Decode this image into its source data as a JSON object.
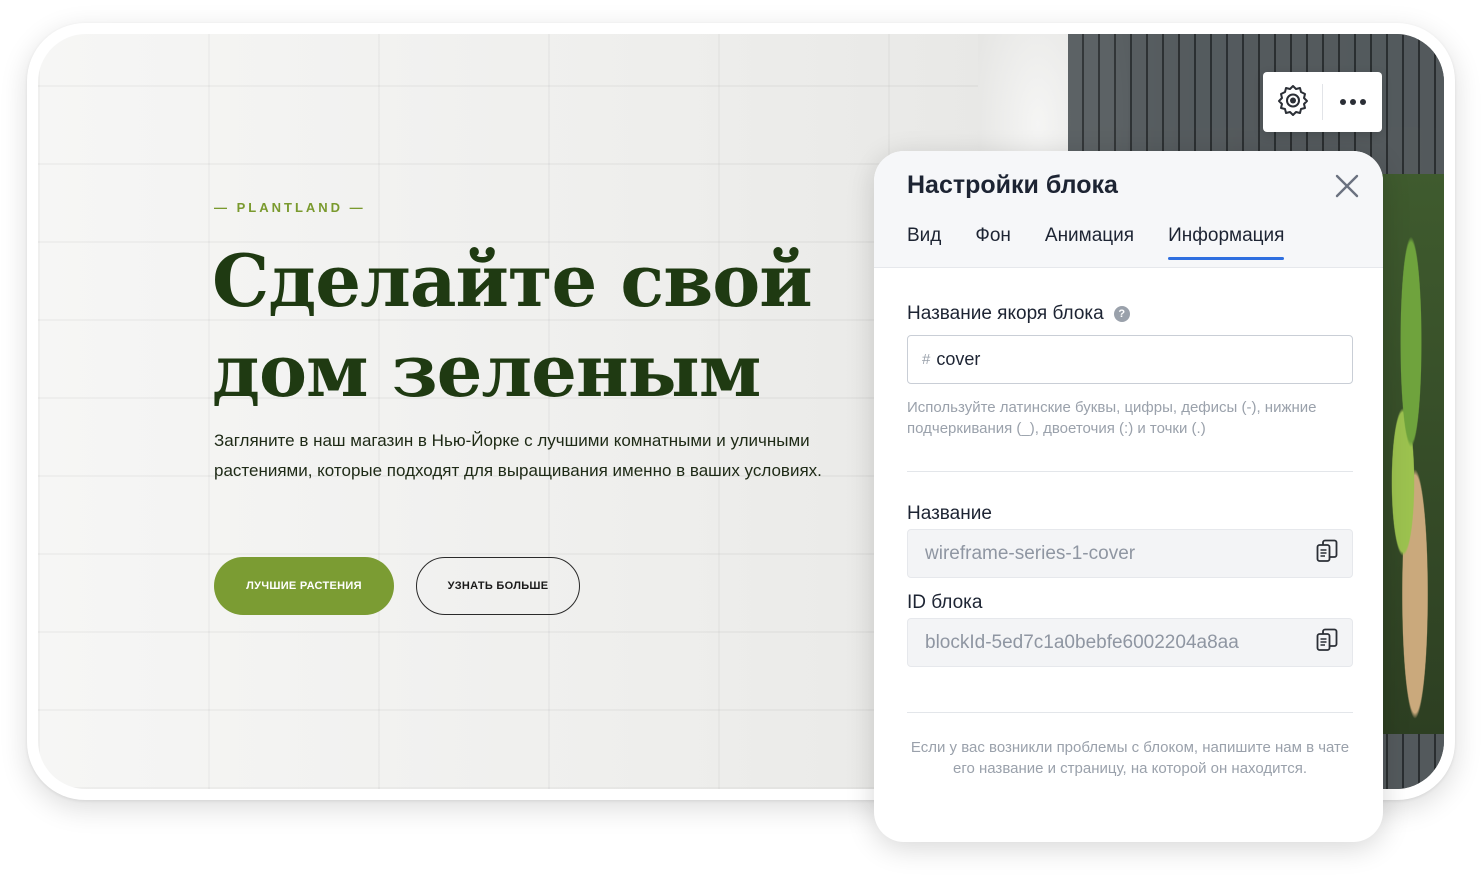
{
  "hero": {
    "eyebrow": "— PLANTLAND —",
    "headline": "Сделайте свой дом зеленым",
    "lead": "Загляните в наш магазин в Нью-Йорке с лучшими комнатными и уличными растениями, которые подходят для выращивания именно в ваших условиях.",
    "primary_button": "ЛУЧШИЕ РАСТЕНИЯ",
    "secondary_button": "УЗНАТЬ БОЛЬШЕ",
    "colors": {
      "accent": "#7b9c33",
      "headline": "#1f3a12",
      "eyebrow": "#7a9a2e"
    }
  },
  "toolbar": {
    "items": [
      {
        "icon": "gear-icon"
      },
      {
        "icon": "more-icon"
      }
    ]
  },
  "panel": {
    "title": "Настройки блока",
    "close_icon": "close-icon",
    "tabs": [
      {
        "label": "Вид",
        "active": false
      },
      {
        "label": "Фон",
        "active": false
      },
      {
        "label": "Анимация",
        "active": false
      },
      {
        "label": "Информация",
        "active": true
      }
    ],
    "anchor": {
      "label": "Название якоря блока",
      "help": "?",
      "prefix": "#",
      "value": "cover",
      "hint": "Используйте латинские буквы, цифры, дефисы (-), нижние подчеркивания (_), двоеточия (:) и точки (.)"
    },
    "name": {
      "label": "Название",
      "value": "wireframe-series-1-cover"
    },
    "block_id": {
      "label": "ID блока",
      "value": "blockId-5ed7c1a0bebfe6002204a8aa"
    },
    "footer_note": "Если у вас возникли проблемы с блоком, напишите нам в чате его название и страницу, на которой он находится.",
    "colors": {
      "active_tab": "#2f6fe0",
      "muted_text": "#9aa1ab"
    }
  }
}
